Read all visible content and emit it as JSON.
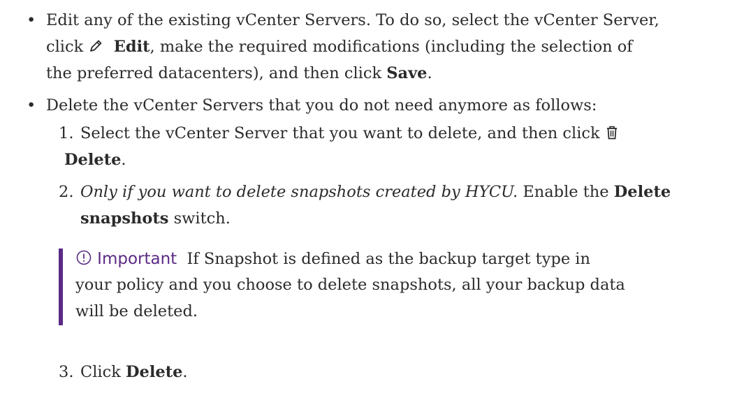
{
  "bullet1": {
    "line1": "Edit any of the existing vCenter Servers. To do so, select the vCenter Server,",
    "line2_pre": "click ",
    "edit_icon": "pencil-icon",
    "line2_bold": "Edit",
    "line2_post": ", make the required modifications (including the selection of",
    "line3_pre": "the preferred datacenters), and then click ",
    "line3_bold": "Save",
    "line3_post": "."
  },
  "bullet2": {
    "line1": "Delete the vCenter Servers that you do not need anymore as follows:"
  },
  "steps": [
    {
      "number": "1.",
      "line1": "Select the vCenter Server that you want to delete, and then click ",
      "icon": "trash-icon",
      "line2_bold": "Delete",
      "line2_post": "."
    },
    {
      "number": "2.",
      "italic": "Only if you want to delete snapshots created by HYCU.",
      "line1_post": " Enable the ",
      "line1_bold": "Delete",
      "line2_bold": "snapshots",
      "line2_post": " switch."
    },
    {
      "number": "3.",
      "pre": "Click ",
      "bold": "Delete",
      "post": "."
    }
  ],
  "callout": {
    "icon": "exclamation-circle-icon",
    "label": "Important",
    "line1": "If Snapshot is defined as the backup target type in",
    "line2": "your policy and you choose to delete snapshots, all your backup data",
    "line3": "will be deleted.",
    "accent_color": "#5b2a86"
  }
}
